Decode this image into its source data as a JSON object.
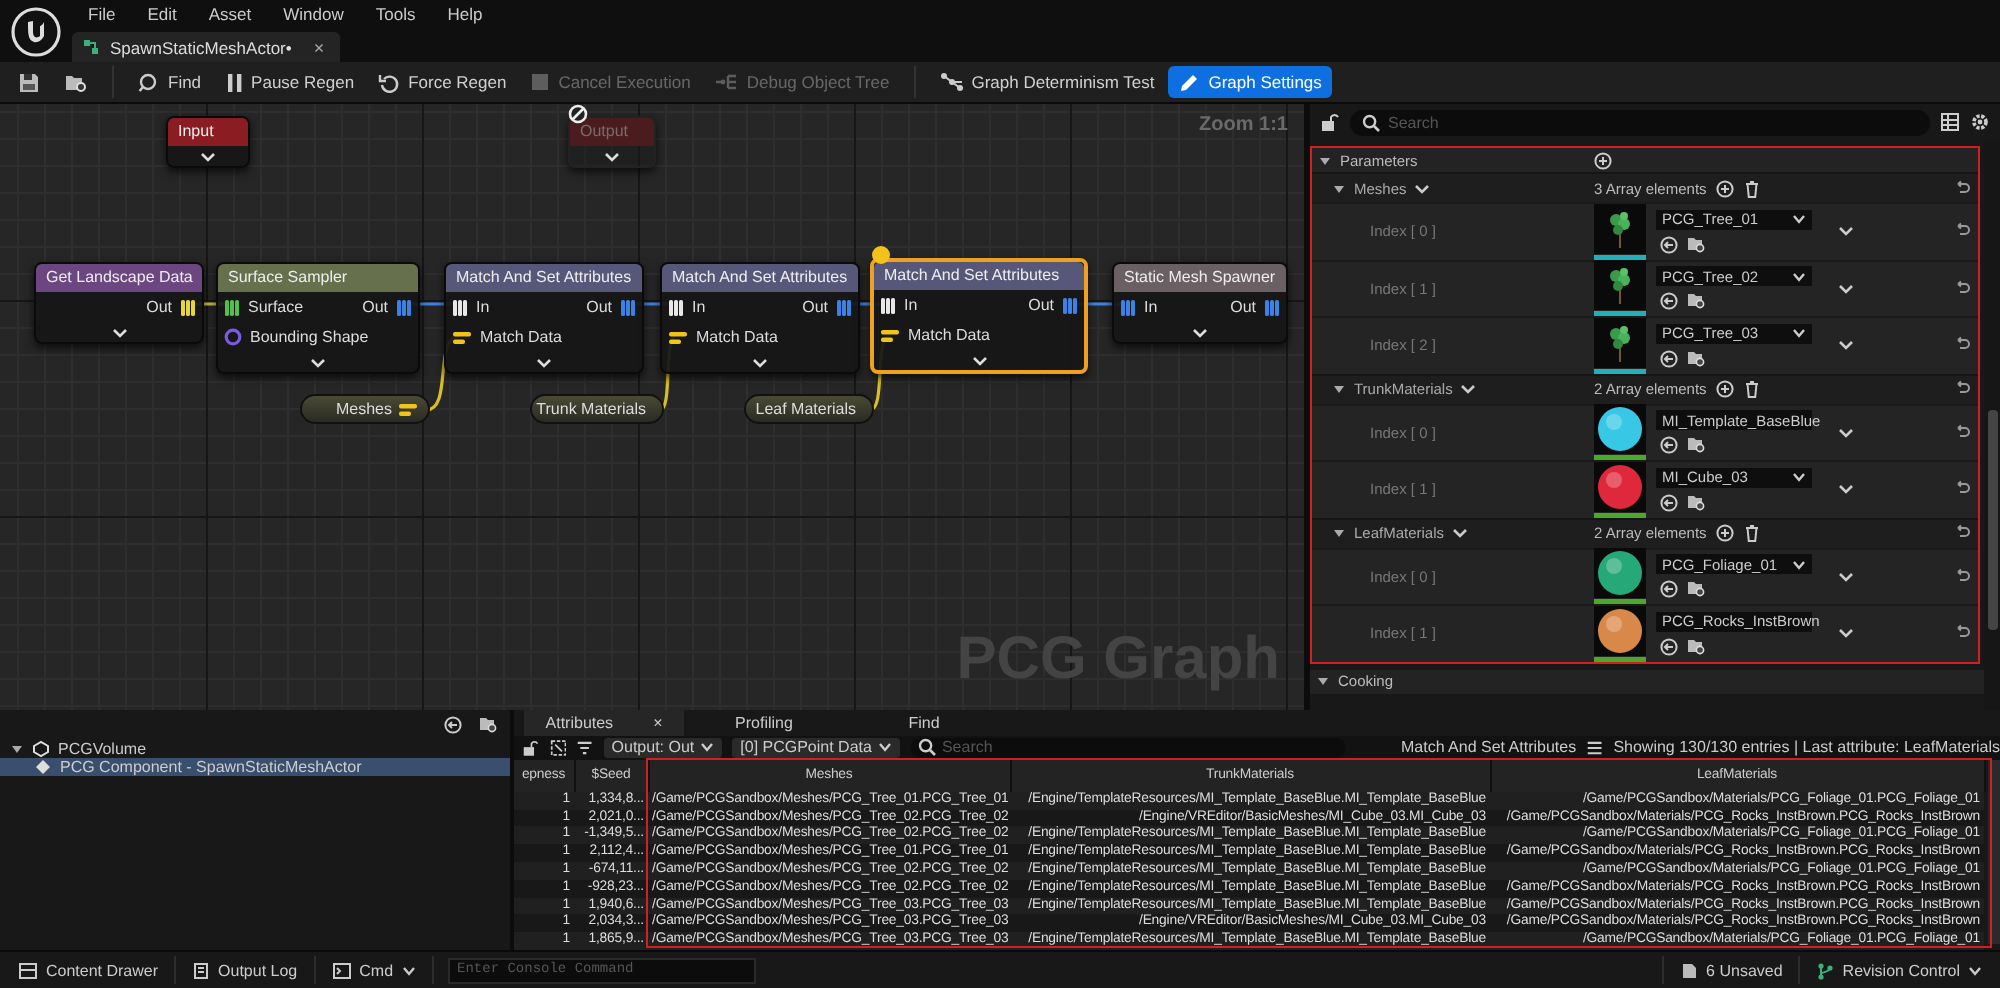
{
  "menu": [
    "File",
    "Edit",
    "Asset",
    "Window",
    "Tools",
    "Help"
  ],
  "document_tab": {
    "label": "SpawnStaticMeshActor•",
    "close": "×",
    "selected": true
  },
  "toolbar": [
    {
      "kind": "save",
      "disabled": false,
      "active": false
    },
    {
      "kind": "browse",
      "disabled": false,
      "active": false
    },
    {
      "kind": "find",
      "label": "Find",
      "disabled": false,
      "active": false
    },
    {
      "kind": "pause",
      "label": "Pause Regen",
      "disabled": false,
      "active": false
    },
    {
      "kind": "regen",
      "label": "Force Regen",
      "disabled": false,
      "active": false
    },
    {
      "kind": "cancel",
      "label": "Cancel Execution",
      "disabled": true,
      "active": false
    },
    {
      "kind": "debug",
      "label": "Debug Object Tree",
      "disabled": true,
      "active": false
    },
    {
      "kind": "determinism",
      "label": "Graph Determinism Test",
      "disabled": false,
      "active": false
    },
    {
      "kind": "settings",
      "label": "Graph Settings",
      "disabled": false,
      "active": true
    }
  ],
  "graph": {
    "zoom_label": "Zoom 1:1",
    "title_overlay": "PCG Graph",
    "nodes": [
      {
        "title": "Input",
        "color": "#8a1c22",
        "selected": false,
        "disabled": false,
        "inspected": false
      },
      {
        "title": "Output",
        "color": "#4a1c1e",
        "selected": false,
        "disabled": true,
        "inspected": false
      },
      {
        "title": "Get Landscape Data",
        "color": "#6c4680",
        "selected": false,
        "disabled": false,
        "inspected": false,
        "outputs": [
          {
            "label": "Out",
            "kind": "landscape"
          }
        ]
      },
      {
        "title": "Surface Sampler",
        "color": "#66704c",
        "selected": false,
        "disabled": false,
        "inspected": false,
        "inputs": [
          {
            "label": "Surface",
            "kind": "surface"
          },
          {
            "label": "Bounding Shape",
            "kind": "spatial"
          }
        ],
        "outputs": [
          {
            "label": "Out",
            "kind": "point"
          }
        ]
      },
      {
        "title": "Match And Set Attributes",
        "color": "#57577a",
        "selected": false,
        "disabled": false,
        "inspected": false,
        "inputs": [
          {
            "label": "In",
            "kind": "any"
          },
          {
            "label": "Match Data",
            "kind": "param"
          }
        ],
        "outputs": [
          {
            "label": "Out",
            "kind": "point"
          }
        ]
      },
      {
        "title": "Match And Set Attributes",
        "color": "#57577a",
        "selected": false,
        "disabled": false,
        "inspected": false,
        "inputs": [
          {
            "label": "In",
            "kind": "any"
          },
          {
            "label": "Match Data",
            "kind": "param"
          }
        ],
        "outputs": [
          {
            "label": "Out",
            "kind": "point"
          }
        ]
      },
      {
        "title": "Match And Set Attributes",
        "color": "#57577a",
        "selected": true,
        "disabled": false,
        "inspected": true,
        "inputs": [
          {
            "label": "In",
            "kind": "any"
          },
          {
            "label": "Match Data",
            "kind": "param"
          }
        ],
        "outputs": [
          {
            "label": "Out",
            "kind": "point"
          }
        ]
      },
      {
        "title": "Static Mesh Spawner",
        "color": "#6a5f62",
        "selected": false,
        "disabled": false,
        "inspected": false,
        "inputs": [
          {
            "label": "In",
            "kind": "point"
          }
        ],
        "outputs": [
          {
            "label": "Out",
            "kind": "point"
          }
        ]
      }
    ],
    "pills": [
      {
        "label": "Meshes"
      },
      {
        "label": "Trunk Materials"
      },
      {
        "label": "Leaf Materials"
      }
    ]
  },
  "details": {
    "search_placeholder": "Search",
    "sections": [
      {
        "title": "Parameters",
        "expanded": true,
        "groups": [
          {
            "name": "Meshes",
            "expanded": true,
            "count": "3 Array elements",
            "items": [
              {
                "index": "Index [ 0 ]",
                "value": "PCG_Tree_01",
                "kind": "tree"
              },
              {
                "index": "Index [ 1 ]",
                "value": "PCG_Tree_02",
                "kind": "tree"
              },
              {
                "index": "Index [ 2 ]",
                "value": "PCG_Tree_03",
                "kind": "tree"
              }
            ]
          },
          {
            "name": "TrunkMaterials",
            "expanded": true,
            "count": "2 Array elements",
            "items": [
              {
                "index": "Index [ 0 ]",
                "value": "MI_Template_BaseBlue",
                "kind": "sphere",
                "color": "#38c8e6"
              },
              {
                "index": "Index [ 1 ]",
                "value": "MI_Cube_03",
                "kind": "sphere",
                "color": "#e0283c"
              }
            ]
          },
          {
            "name": "LeafMaterials",
            "expanded": true,
            "count": "2 Array elements",
            "items": [
              {
                "index": "Index [ 0 ]",
                "value": "PCG_Foliage_01",
                "kind": "sphere",
                "color": "#27a878"
              },
              {
                "index": "Index [ 1 ]",
                "value": "PCG_Rocks_InstBrown",
                "kind": "sphere",
                "color": "#d8894a"
              }
            ]
          }
        ]
      },
      {
        "title": "Cooking",
        "expanded": true
      }
    ]
  },
  "outliner": {
    "items": [
      {
        "label": "PCGVolume",
        "expanded": true,
        "selected": false,
        "children": [
          {
            "label": "PCG Component - SpawnStaticMeshActor",
            "selected": true
          }
        ]
      }
    ]
  },
  "attributes": {
    "tabs": [
      {
        "label": "Attributes",
        "selected": true,
        "close": "×"
      },
      {
        "label": "Profiling",
        "selected": false
      },
      {
        "label": "Find",
        "selected": false
      }
    ],
    "output_dropdown": "Output: Out",
    "data_dropdown": "[0] PCGPoint Data",
    "search_placeholder": "Search",
    "node_name": "Match And Set Attributes",
    "summary": "Showing 130/130 entries | Last attribute: LeafMaterials",
    "table": {
      "columns": [
        "epness",
        "$Seed",
        "Meshes",
        "TrunkMaterials",
        "LeafMaterials"
      ],
      "rows": [
        [
          "1",
          "1,334,8...",
          "/Game/PCGSandbox/Meshes/PCG_Tree_01.PCG_Tree_01",
          "/Engine/TemplateResources/MI_Template_BaseBlue.MI_Template_BaseBlue",
          "/Game/PCGSandbox/Materials/PCG_Foliage_01.PCG_Foliage_01"
        ],
        [
          "1",
          "2,021,0...",
          "/Game/PCGSandbox/Meshes/PCG_Tree_02.PCG_Tree_02",
          "/Engine/VREditor/BasicMeshes/MI_Cube_03.MI_Cube_03",
          "/Game/PCGSandbox/Materials/PCG_Rocks_InstBrown.PCG_Rocks_InstBrown"
        ],
        [
          "1",
          "-1,349,5...",
          "/Game/PCGSandbox/Meshes/PCG_Tree_02.PCG_Tree_02",
          "/Engine/TemplateResources/MI_Template_BaseBlue.MI_Template_BaseBlue",
          "/Game/PCGSandbox/Materials/PCG_Foliage_01.PCG_Foliage_01"
        ],
        [
          "1",
          "2,112,4...",
          "/Game/PCGSandbox/Meshes/PCG_Tree_01.PCG_Tree_01",
          "/Engine/TemplateResources/MI_Template_BaseBlue.MI_Template_BaseBlue",
          "/Game/PCGSandbox/Materials/PCG_Rocks_InstBrown.PCG_Rocks_InstBrown"
        ],
        [
          "1",
          "-674,11...",
          "/Game/PCGSandbox/Meshes/PCG_Tree_02.PCG_Tree_02",
          "/Engine/TemplateResources/MI_Template_BaseBlue.MI_Template_BaseBlue",
          "/Game/PCGSandbox/Materials/PCG_Foliage_01.PCG_Foliage_01"
        ],
        [
          "1",
          "-928,23...",
          "/Game/PCGSandbox/Meshes/PCG_Tree_02.PCG_Tree_02",
          "/Engine/TemplateResources/MI_Template_BaseBlue.MI_Template_BaseBlue",
          "/Game/PCGSandbox/Materials/PCG_Rocks_InstBrown.PCG_Rocks_InstBrown"
        ],
        [
          "1",
          "1,940,6...",
          "/Game/PCGSandbox/Meshes/PCG_Tree_03.PCG_Tree_03",
          "/Engine/TemplateResources/MI_Template_BaseBlue.MI_Template_BaseBlue",
          "/Game/PCGSandbox/Materials/PCG_Rocks_InstBrown.PCG_Rocks_InstBrown"
        ],
        [
          "1",
          "2,034,3...",
          "/Game/PCGSandbox/Meshes/PCG_Tree_03.PCG_Tree_03",
          "/Engine/VREditor/BasicMeshes/MI_Cube_03.MI_Cube_03",
          "/Game/PCGSandbox/Materials/PCG_Rocks_InstBrown.PCG_Rocks_InstBrown"
        ],
        [
          "1",
          "1,865,9...",
          "/Game/PCGSandbox/Meshes/PCG_Tree_03.PCG_Tree_03",
          "/Engine/TemplateResources/MI_Template_BaseBlue.MI_Template_BaseBlue",
          "/Game/PCGSandbox/Materials/PCG_Foliage_01.PCG_Foliage_01"
        ]
      ]
    }
  },
  "status_bar": {
    "left": [
      {
        "label": "Content Drawer",
        "kind": "drawer"
      },
      {
        "label": "Output Log",
        "kind": "log"
      },
      {
        "label": "Cmd",
        "kind": "cmd"
      }
    ],
    "console_placeholder": "Enter Console Command",
    "right": [
      {
        "label": "6 Unsaved",
        "kind": "unsaved"
      },
      {
        "label": "Revision Control",
        "kind": "revision"
      }
    ]
  }
}
